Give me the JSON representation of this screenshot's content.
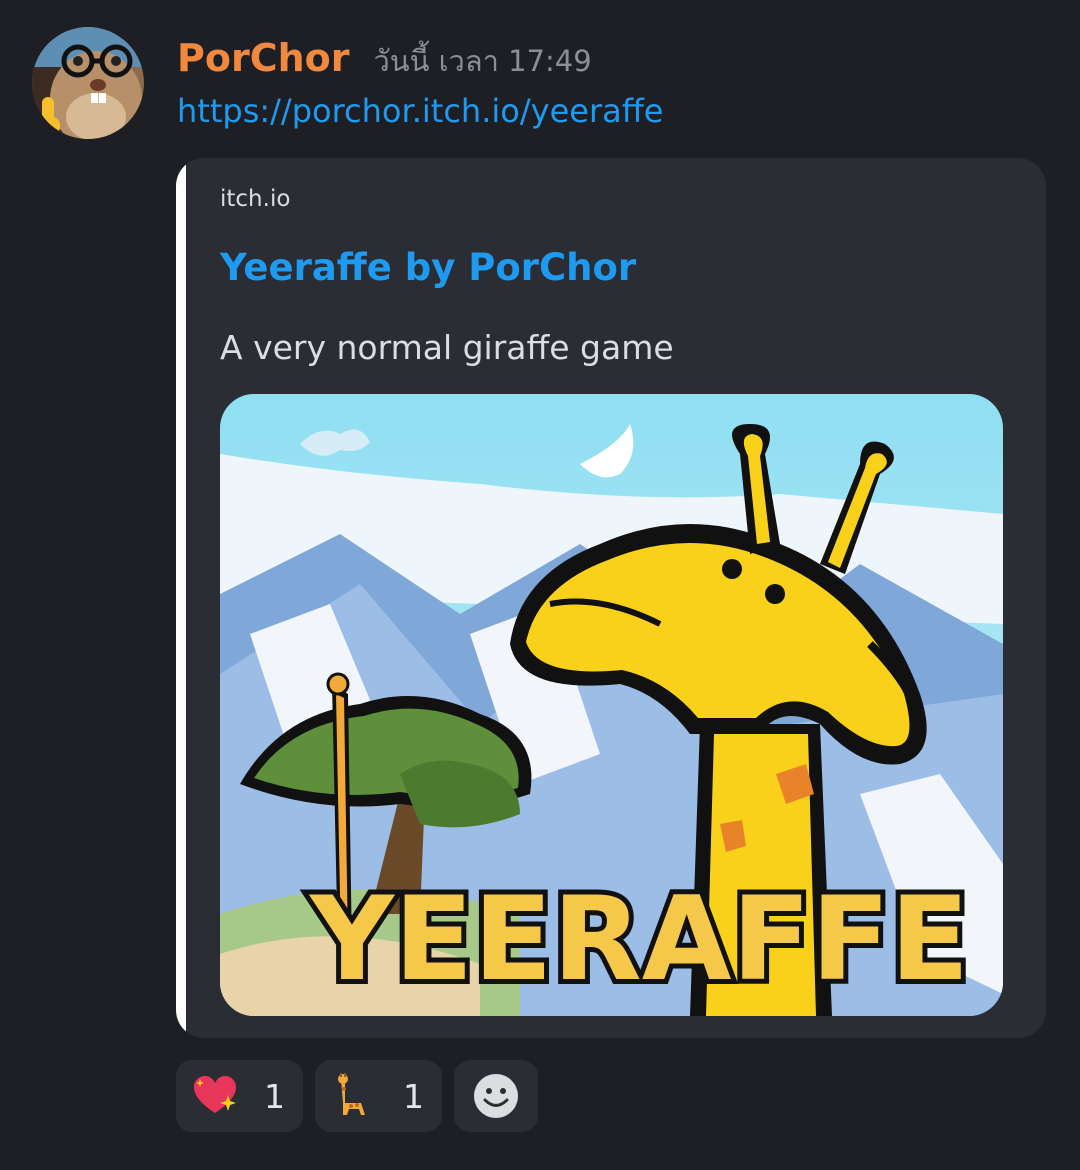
{
  "message": {
    "author": "PorChor",
    "timestamp": "วันนี้ เวลา 17:49",
    "link": "https://porchor.itch.io/yeeraffe",
    "author_color": "#f0883e",
    "link_color": "#1e9bf0"
  },
  "embed": {
    "provider": "itch.io",
    "title": "Yeeraffe by PorChor",
    "description": "A very normal giraffe game",
    "image_logo_text": "YEERAFFE",
    "accent_color": "#ffffff"
  },
  "reactions": [
    {
      "emoji": "sparkling-heart-icon",
      "count": "1"
    },
    {
      "emoji": "giraffe-icon",
      "count": "1"
    }
  ],
  "add_reaction": {
    "icon": "smiley-add-reaction-icon"
  }
}
